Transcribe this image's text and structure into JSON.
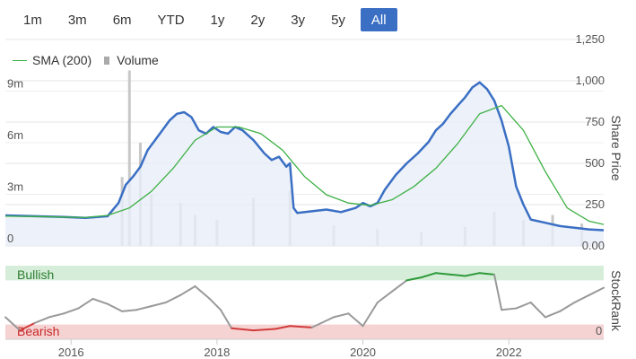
{
  "range_selector": {
    "buttons": [
      "1m",
      "3m",
      "6m",
      "YTD",
      "1y",
      "2y",
      "3y",
      "5y",
      "All"
    ],
    "active": "All"
  },
  "legend": {
    "sma_label": "SMA (200)",
    "volume_label": "Volume"
  },
  "colors": {
    "price_line": "#3a6fc4",
    "price_fill": "#e8edf7",
    "sma_line": "#3cb043",
    "volume_bars": "#c8c8c8",
    "active_button": "#3a6fc4",
    "bullish_zone": "#d6eed9",
    "bearish_zone": "#f6d3d3",
    "rank_neutral": "#999999",
    "rank_bullish": "#2e9a3a",
    "rank_bearish": "#d23b3b"
  },
  "chart_data": [
    {
      "type": "line",
      "title": "",
      "y_axis_right": {
        "label": "Share Price",
        "ticks": [
          "1,250",
          "1,000",
          "750",
          "500",
          "250",
          "0.00"
        ],
        "ylim": [
          0,
          1250
        ]
      },
      "y_axis_left_volume": {
        "ticks": [
          "9m",
          "6m",
          "3m",
          "0"
        ],
        "ylim": [
          0,
          12
        ]
      },
      "x_axis": {
        "ticks": [
          "2016",
          "2018",
          "2020",
          "2022"
        ],
        "xlim": [
          2015.1,
          2023.3
        ]
      },
      "grid": true,
      "legend_position": "top-left",
      "series": [
        {
          "name": "Share Price",
          "x": [
            2015.1,
            2015.5,
            2015.9,
            2016.2,
            2016.5,
            2016.65,
            2016.75,
            2016.85,
            2016.95,
            2017.05,
            2017.15,
            2017.25,
            2017.35,
            2017.45,
            2017.55,
            2017.65,
            2017.75,
            2017.85,
            2017.95,
            2018.05,
            2018.15,
            2018.25,
            2018.35,
            2018.5,
            2018.65,
            2018.75,
            2018.85,
            2018.95,
            2019.0,
            2019.05,
            2019.1,
            2019.3,
            2019.5,
            2019.7,
            2019.9,
            2020.0,
            2020.1,
            2020.2,
            2020.3,
            2020.45,
            2020.6,
            2020.75,
            2020.9,
            2021.0,
            2021.1,
            2021.2,
            2021.3,
            2021.4,
            2021.5,
            2021.6,
            2021.7,
            2021.8,
            2021.9,
            2022.0,
            2022.1,
            2022.2,
            2022.3,
            2022.5,
            2022.7,
            2022.9,
            2023.1,
            2023.3
          ],
          "values": [
            185,
            180,
            175,
            170,
            180,
            260,
            370,
            420,
            480,
            580,
            640,
            700,
            760,
            800,
            810,
            780,
            700,
            680,
            720,
            690,
            680,
            720,
            700,
            640,
            560,
            520,
            540,
            480,
            500,
            230,
            200,
            210,
            220,
            205,
            230,
            260,
            240,
            260,
            340,
            430,
            500,
            560,
            630,
            700,
            740,
            800,
            850,
            900,
            960,
            990,
            950,
            880,
            760,
            600,
            360,
            250,
            160,
            140,
            120,
            110,
            100,
            95
          ]
        },
        {
          "name": "SMA (200)",
          "x": [
            2015.1,
            2015.5,
            2015.9,
            2016.2,
            2016.5,
            2016.8,
            2017.1,
            2017.4,
            2017.7,
            2018.0,
            2018.3,
            2018.6,
            2018.9,
            2019.2,
            2019.5,
            2019.8,
            2020.1,
            2020.4,
            2020.7,
            2021.0,
            2021.3,
            2021.6,
            2021.9,
            2022.2,
            2022.5,
            2022.8,
            2023.1,
            2023.3
          ],
          "values": [
            180,
            178,
            175,
            172,
            185,
            230,
            330,
            470,
            640,
            720,
            720,
            680,
            580,
            420,
            310,
            260,
            245,
            280,
            360,
            470,
            620,
            800,
            850,
            700,
            450,
            230,
            150,
            130
          ]
        },
        {
          "name": "Volume",
          "note_units": "millions",
          "x": [
            2016.7,
            2016.8,
            2016.95,
            2017.1,
            2017.5,
            2017.7,
            2018.0,
            2018.5,
            2019.0,
            2019.6,
            2020.2,
            2020.8,
            2021.4,
            2021.8,
            2022.2,
            2022.6,
            2023.0
          ],
          "values": [
            4.0,
            10.2,
            6.0,
            3.0,
            2.5,
            1.8,
            1.5,
            2.8,
            3.2,
            1.2,
            1.0,
            0.8,
            1.1,
            2.0,
            1.5,
            1.8,
            1.3
          ]
        }
      ]
    },
    {
      "type": "line",
      "title": "",
      "y_axis_right": {
        "label": "StockRank",
        "ticks": [
          "0"
        ],
        "ylim": [
          0,
          100
        ]
      },
      "zones": [
        {
          "label": "Bullish",
          "range": [
            80,
            100
          ]
        },
        {
          "label": "Bearish",
          "range": [
            0,
            20
          ]
        }
      ],
      "x_axis": {
        "ticks": [
          "2016",
          "2018",
          "2020",
          "2022"
        ],
        "xlim": [
          2015.1,
          2023.3
        ]
      },
      "series": [
        {
          "name": "StockRank",
          "x": [
            2015.1,
            2015.3,
            2015.5,
            2015.7,
            2015.9,
            2016.1,
            2016.3,
            2016.5,
            2016.7,
            2016.9,
            2017.1,
            2017.3,
            2017.5,
            2017.7,
            2017.9,
            2018.05,
            2018.2,
            2018.5,
            2018.8,
            2019.0,
            2019.3,
            2019.6,
            2019.8,
            2020.0,
            2020.2,
            2020.4,
            2020.6,
            2020.8,
            2021.0,
            2021.2,
            2021.4,
            2021.6,
            2021.8,
            2021.9,
            2022.1,
            2022.3,
            2022.5,
            2022.7,
            2022.9,
            2023.1,
            2023.3
          ],
          "values": [
            30,
            12,
            22,
            30,
            35,
            42,
            55,
            48,
            38,
            40,
            45,
            50,
            60,
            72,
            55,
            40,
            15,
            12,
            14,
            18,
            16,
            30,
            35,
            18,
            50,
            65,
            80,
            84,
            90,
            88,
            86,
            90,
            88,
            40,
            42,
            50,
            30,
            38,
            50,
            60,
            70
          ]
        }
      ]
    }
  ]
}
